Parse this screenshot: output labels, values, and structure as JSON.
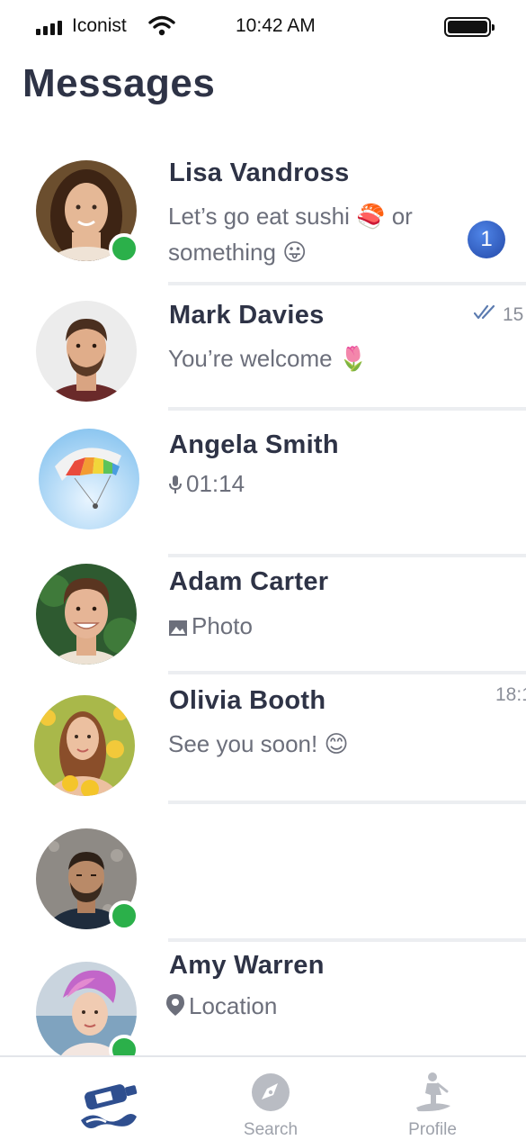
{
  "status_bar": {
    "carrier": "Iconist",
    "time": "10:42 AM"
  },
  "header": {
    "title": "Messages"
  },
  "conversations": [
    {
      "name": "Lisa Vandross",
      "preview_line1": "Let’s go eat sushi 🍣 or",
      "preview_line2": "something 😛",
      "unread_count": "1",
      "online": true
    },
    {
      "name": "Mark Davies",
      "preview_line1": "You’re welcome 🌷",
      "time": "15",
      "read_receipt": "double-check-icon",
      "online": false
    },
    {
      "name": "Angela Smith",
      "preview_line1": "01:14",
      "preview_icon": "microphone-icon",
      "online": false
    },
    {
      "name": "Adam Carter",
      "preview_line1": "Photo",
      "preview_icon": "photo-icon",
      "online": false
    },
    {
      "name": "Olivia Booth",
      "preview_line1": "See you soon! 😊",
      "time": "18:1",
      "online": false
    },
    {
      "name": "",
      "preview_line1": "",
      "online": true
    },
    {
      "name": "Amy Warren",
      "preview_line1": "Location",
      "preview_icon": "location-pin-icon",
      "online": true
    }
  ],
  "tab_bar": {
    "tabs": [
      {
        "label": "",
        "icon": "messages-bottle-icon",
        "active": true
      },
      {
        "label": "Search",
        "icon": "compass-icon",
        "active": false
      },
      {
        "label": "Profile",
        "icon": "surfer-icon",
        "active": false
      }
    ]
  },
  "colors": {
    "title_text": "#2e3346",
    "secondary_text": "#6c6f7b",
    "online_green": "#2bb04a",
    "badge_blue": "#2f5fc4",
    "active_tab": "#2f4f8f",
    "inactive_tab": "#9ea2ab"
  }
}
